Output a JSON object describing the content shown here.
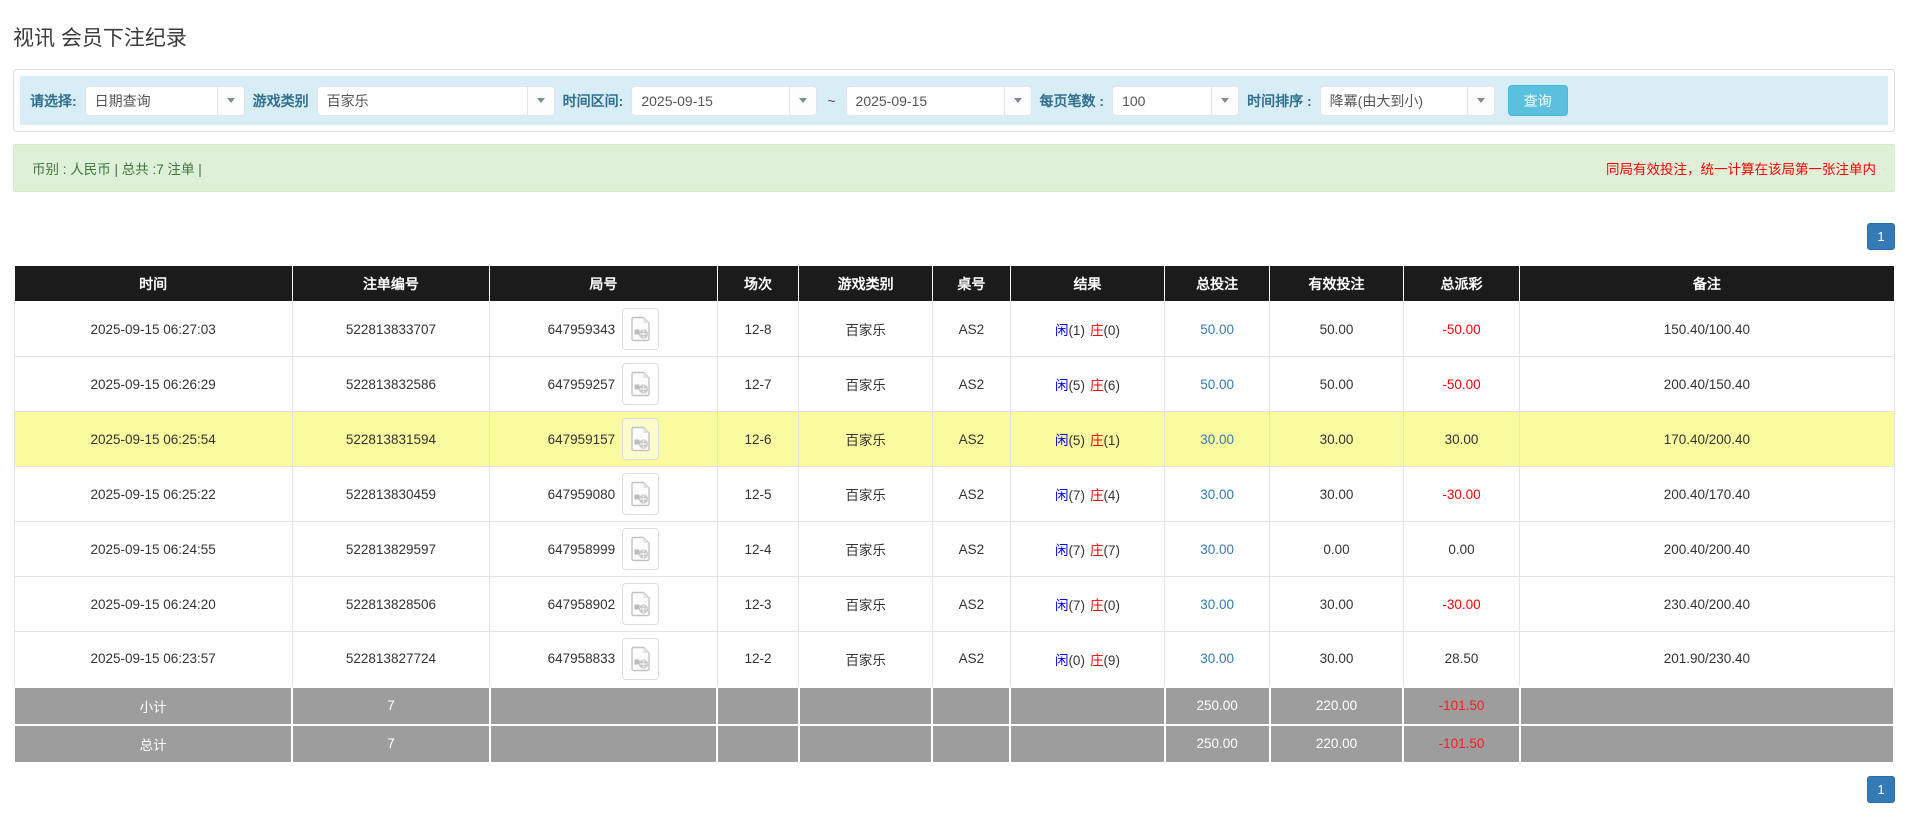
{
  "page": {
    "title": "视讯 会员下注纪录"
  },
  "filters": {
    "select_label": "请选择:",
    "select_value": "日期查询",
    "game_type_label": "游戏类别",
    "game_type_value": "百家乐",
    "date_range_label": "时间区间:",
    "date_from": "2025-09-15",
    "range_separator": "~",
    "date_to": "2025-09-15",
    "page_size_label": "每页笔数 :",
    "page_size_value": "100",
    "sort_label": "时间排序 :",
    "sort_value": "降冪(由大到小)",
    "search_button": "查询"
  },
  "summary_bar": {
    "left_text": "币别 : 人民币 | 总共 :7 注单 |",
    "right_notice": "同局有效投注，统一计算在该局第一张注单内"
  },
  "pagination": {
    "page": "1"
  },
  "table": {
    "headers": [
      "时间",
      "注单编号",
      "局号",
      "场次",
      "游戏类别",
      "桌号",
      "结果",
      "总投注",
      "有效投注",
      "总派彩",
      "备注"
    ],
    "rows": [
      {
        "time": "2025-09-15 06:27:03",
        "bet_id": "522813833707",
        "round_id": "647959343",
        "session": "12-8",
        "game": "百家乐",
        "table_no": "AS2",
        "player": "闲",
        "player_n": "(1)",
        "banker": "庄",
        "banker_n": "(0)",
        "total_bet": "50.00",
        "valid_bet": "50.00",
        "payout": "-50.00",
        "note": "150.40/100.40",
        "highlight": false
      },
      {
        "time": "2025-09-15 06:26:29",
        "bet_id": "522813832586",
        "round_id": "647959257",
        "session": "12-7",
        "game": "百家乐",
        "table_no": "AS2",
        "player": "闲",
        "player_n": "(5)",
        "banker": "庄",
        "banker_n": "(6)",
        "total_bet": "50.00",
        "valid_bet": "50.00",
        "payout": "-50.00",
        "note": "200.40/150.40",
        "highlight": false
      },
      {
        "time": "2025-09-15 06:25:54",
        "bet_id": "522813831594",
        "round_id": "647959157",
        "session": "12-6",
        "game": "百家乐",
        "table_no": "AS2",
        "player": "闲",
        "player_n": "(5)",
        "banker": "庄",
        "banker_n": "(1)",
        "total_bet": "30.00",
        "valid_bet": "30.00",
        "payout": "30.00",
        "note": "170.40/200.40",
        "highlight": true
      },
      {
        "time": "2025-09-15 06:25:22",
        "bet_id": "522813830459",
        "round_id": "647959080",
        "session": "12-5",
        "game": "百家乐",
        "table_no": "AS2",
        "player": "闲",
        "player_n": "(7)",
        "banker": "庄",
        "banker_n": "(4)",
        "total_bet": "30.00",
        "valid_bet": "30.00",
        "payout": "-30.00",
        "note": "200.40/170.40",
        "highlight": false
      },
      {
        "time": "2025-09-15 06:24:55",
        "bet_id": "522813829597",
        "round_id": "647958999",
        "session": "12-4",
        "game": "百家乐",
        "table_no": "AS2",
        "player": "闲",
        "player_n": "(7)",
        "banker": "庄",
        "banker_n": "(7)",
        "total_bet": "30.00",
        "valid_bet": "0.00",
        "payout": "0.00",
        "note": "200.40/200.40",
        "highlight": false
      },
      {
        "time": "2025-09-15 06:24:20",
        "bet_id": "522813828506",
        "round_id": "647958902",
        "session": "12-3",
        "game": "百家乐",
        "table_no": "AS2",
        "player": "闲",
        "player_n": "(7)",
        "banker": "庄",
        "banker_n": "(0)",
        "total_bet": "30.00",
        "valid_bet": "30.00",
        "payout": "-30.00",
        "note": "230.40/200.40",
        "highlight": false
      },
      {
        "time": "2025-09-15 06:23:57",
        "bet_id": "522813827724",
        "round_id": "647958833",
        "session": "12-2",
        "game": "百家乐",
        "table_no": "AS2",
        "player": "闲",
        "player_n": "(0)",
        "banker": "庄",
        "banker_n": "(9)",
        "total_bet": "30.00",
        "valid_bet": "30.00",
        "payout": "28.50",
        "note": "201.90/230.40",
        "highlight": false
      }
    ],
    "subtotal": {
      "label": "小计",
      "count": "7",
      "total_bet": "250.00",
      "valid_bet": "220.00",
      "payout": "-101.50"
    },
    "total": {
      "label": "总计",
      "count": "7",
      "total_bet": "250.00",
      "valid_bet": "220.00",
      "payout": "-101.50"
    }
  },
  "colors": {
    "filter_bar_bg": "#d9edf7",
    "filter_label": "#31708f",
    "search_button": "#5bc0de",
    "notice_bg": "#dff0d8",
    "notice_text": "#3c763d",
    "notice_warning": "#ff0000",
    "table_header_bg": "#1b1b1b",
    "highlight_row": "#fafa9e",
    "summary_row_bg": "#9d9d9d",
    "player_blue": "#0000ff",
    "banker_red": "#ff0000",
    "negative_red": "#ff0000",
    "bet_link_blue": "#337ab7",
    "pager_blue": "#337ab7"
  }
}
